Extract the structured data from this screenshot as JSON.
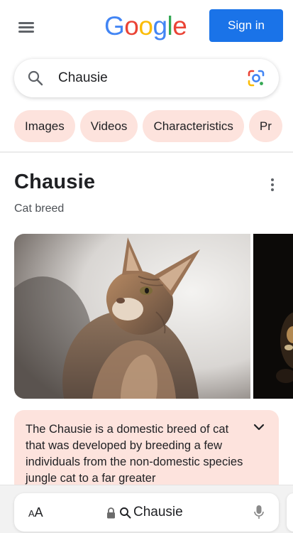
{
  "header": {
    "logo_letters": [
      {
        "ch": "G",
        "color": "#4285f4"
      },
      {
        "ch": "o",
        "color": "#ea4335"
      },
      {
        "ch": "o",
        "color": "#fbbc05"
      },
      {
        "ch": "g",
        "color": "#4285f4"
      },
      {
        "ch": "l",
        "color": "#34a853"
      },
      {
        "ch": "e",
        "color": "#ea4335"
      }
    ],
    "signin_label": "Sign in",
    "signin_color": "#1a73e8"
  },
  "search": {
    "query": "Chausie"
  },
  "chips": [
    {
      "label": "Images"
    },
    {
      "label": "Videos"
    },
    {
      "label": "Characteristics"
    },
    {
      "label": "Pr"
    }
  ],
  "knowledge_panel": {
    "title": "Chausie",
    "subtitle": "Cat breed",
    "description": "The Chausie is a domestic breed of cat that was developed by breeding a few individuals from the non-domestic species jungle cat to a far greater",
    "accent_bg": "#fde3dd"
  },
  "browser_bar": {
    "text_size_label_small": "A",
    "text_size_label_large": "A",
    "address_text": "Chausie"
  }
}
